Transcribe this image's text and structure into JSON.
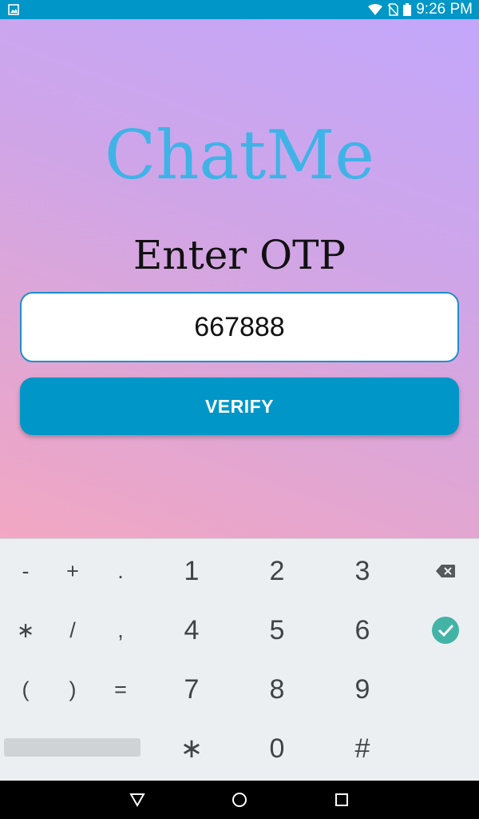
{
  "status_bar": {
    "time": "9:26 PM",
    "icons": [
      "image-notification-icon",
      "wifi-icon",
      "no-sim-icon",
      "battery-icon"
    ]
  },
  "app": {
    "title": "ChatMe",
    "heading": "Enter OTP",
    "otp_input": {
      "value": "667888",
      "placeholder": ""
    },
    "verify_label": "VERIFY",
    "colors": {
      "accent": "#0096c7",
      "title": "#3fb3e6",
      "gradient_top": "#c3a7fb",
      "gradient_bottom": "#f2a7c2"
    }
  },
  "keyboard": {
    "symbols": {
      "minus": "-",
      "plus": "+",
      "dot": ".",
      "star": "∗",
      "slash": "/",
      "comma": ",",
      "lparen": "(",
      "rparen": ")",
      "equals": "="
    },
    "digits": {
      "d1": "1",
      "d2": "2",
      "d3": "3",
      "d4": "4",
      "d5": "5",
      "d6": "6",
      "d7": "7",
      "d8": "8",
      "d9": "9",
      "d0": "0",
      "star": "∗",
      "hash": "#"
    },
    "icons": [
      "backspace-icon",
      "done-check-icon"
    ]
  },
  "nav_bar": {
    "icons": [
      "back-icon",
      "home-icon",
      "recents-icon"
    ]
  }
}
